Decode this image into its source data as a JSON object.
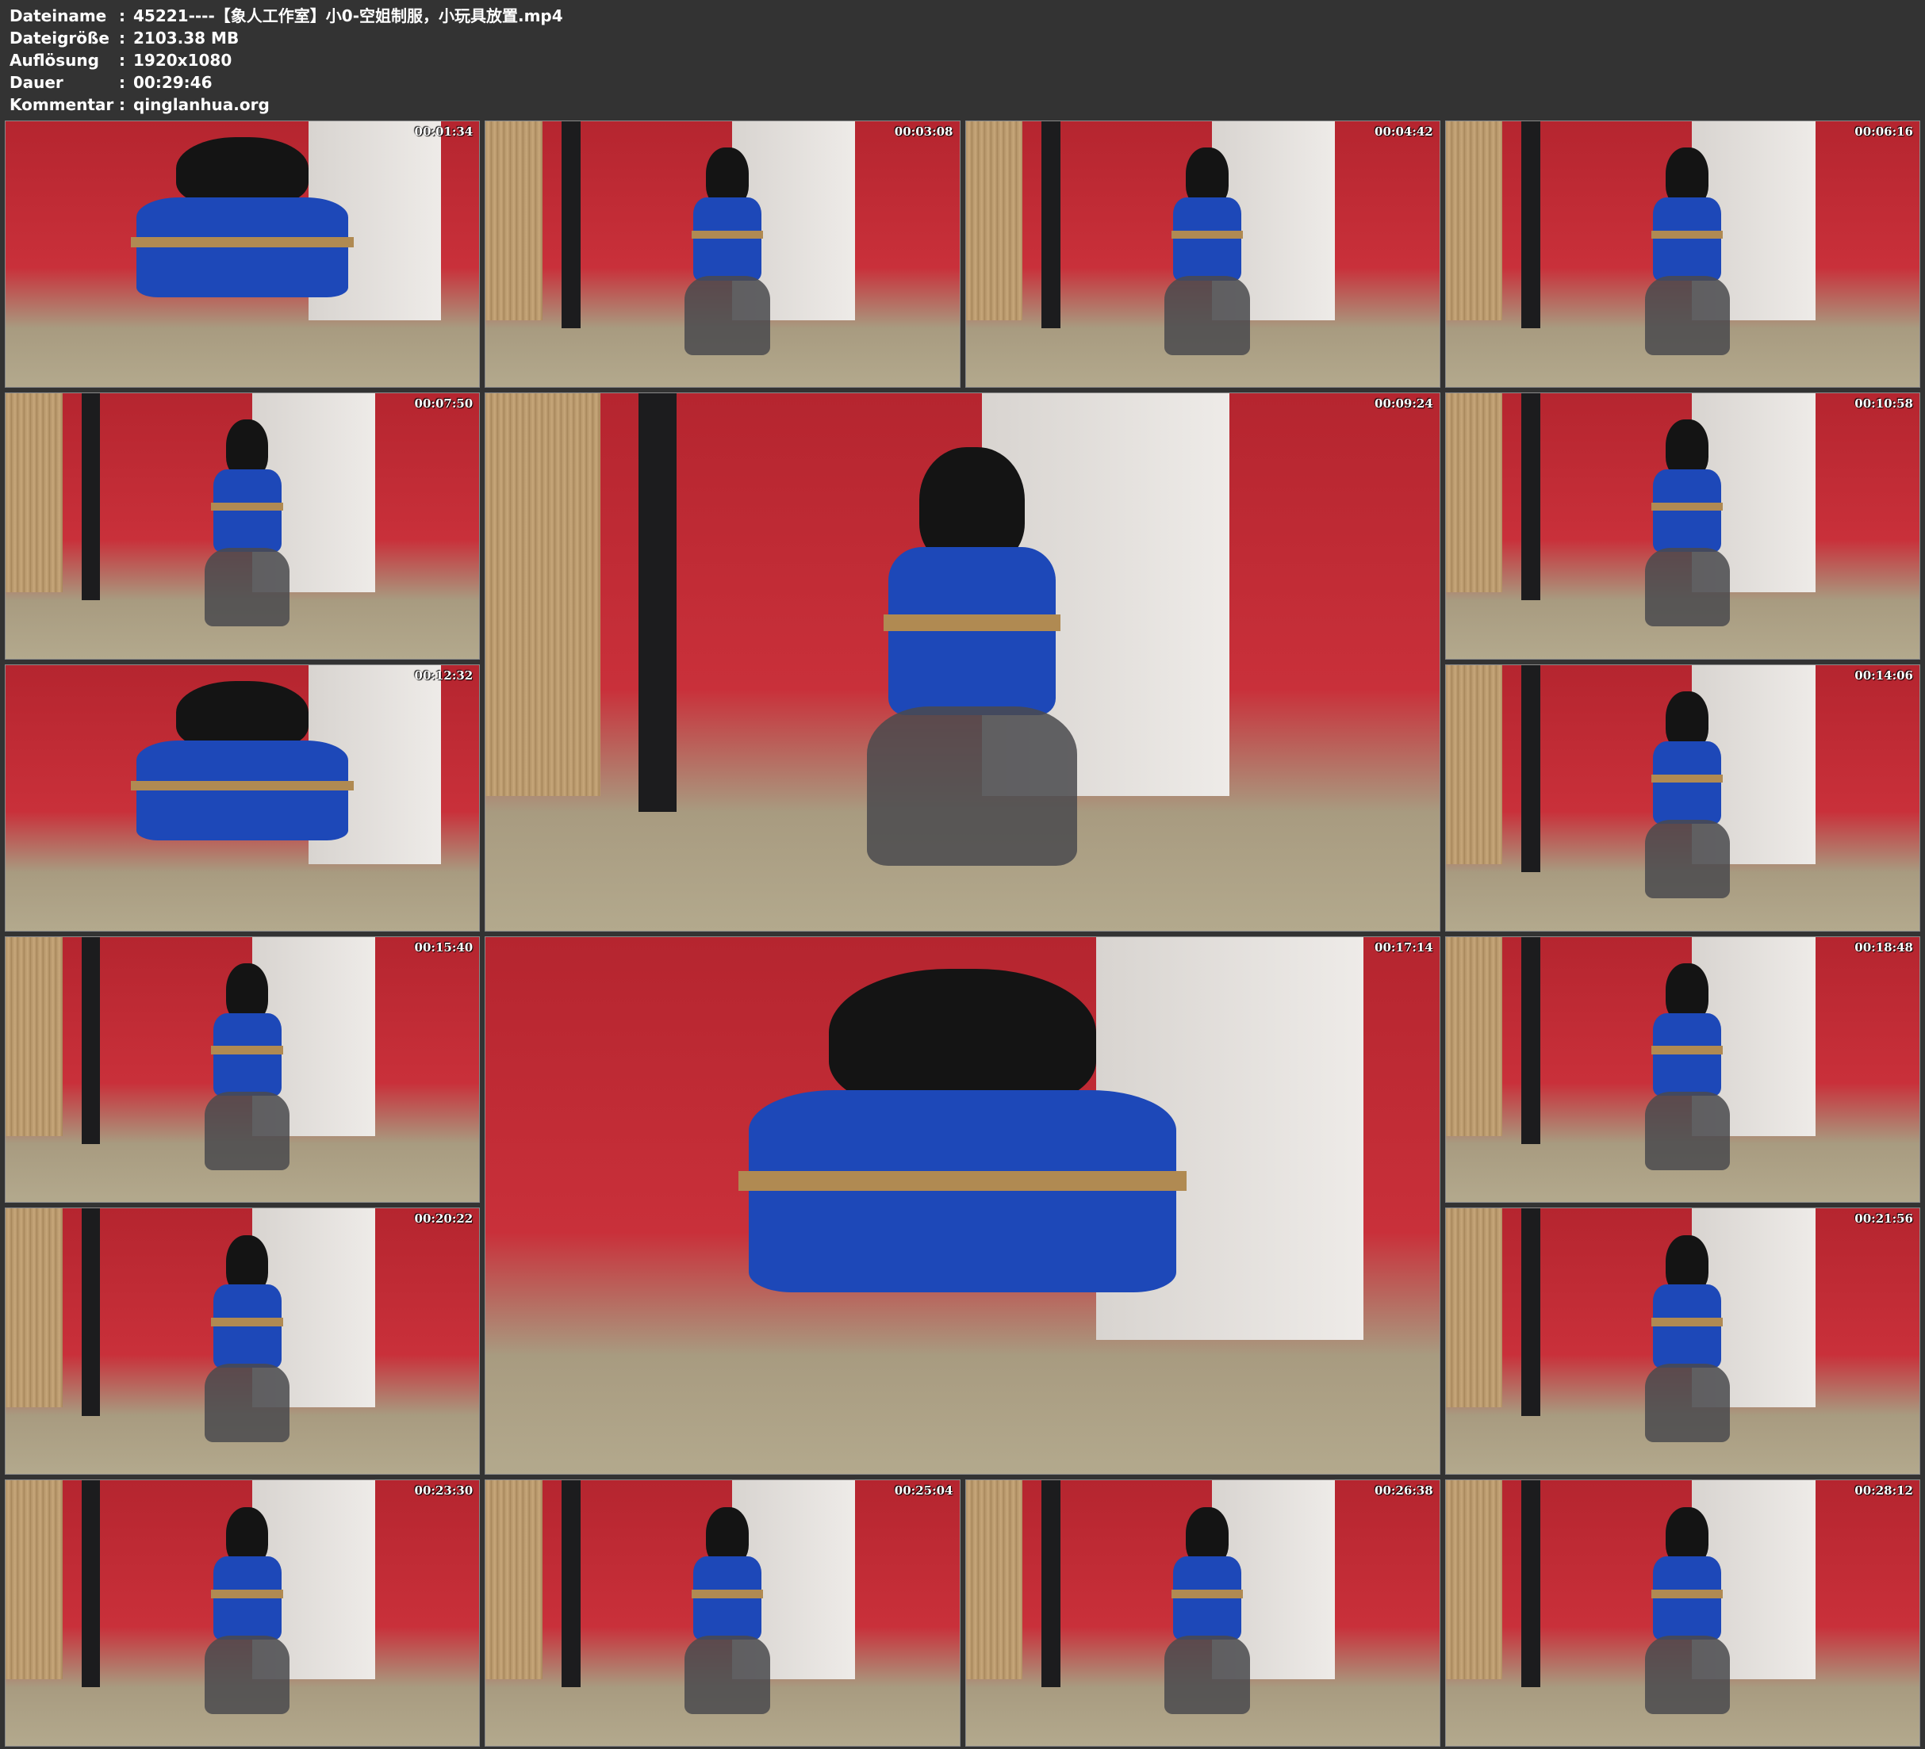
{
  "info": [
    {
      "label": "Dateiname",
      "value": "45221----【象人工作室】小0-空姐制服，小玩具放置.mp4"
    },
    {
      "label": "Dateigröße",
      "value": "2103.38 MB"
    },
    {
      "label": "Auflösung",
      "value": "1920x1080"
    },
    {
      "label": "Dauer",
      "value": "00:29:46"
    },
    {
      "label": "Kommentar",
      "value": "qinglanhua.org"
    }
  ],
  "separator": ":",
  "thumbnails": [
    "00:01:34",
    "00:03:08",
    "00:04:42",
    "00:06:16",
    "00:07:50",
    "00:09:24",
    "00:10:58",
    "00:12:32",
    "00:14:06",
    "00:15:40",
    "00:17:14",
    "00:18:48",
    "00:20:22",
    "00:21:56",
    "00:23:30",
    "00:25:04",
    "00:26:38",
    "00:28:12"
  ]
}
